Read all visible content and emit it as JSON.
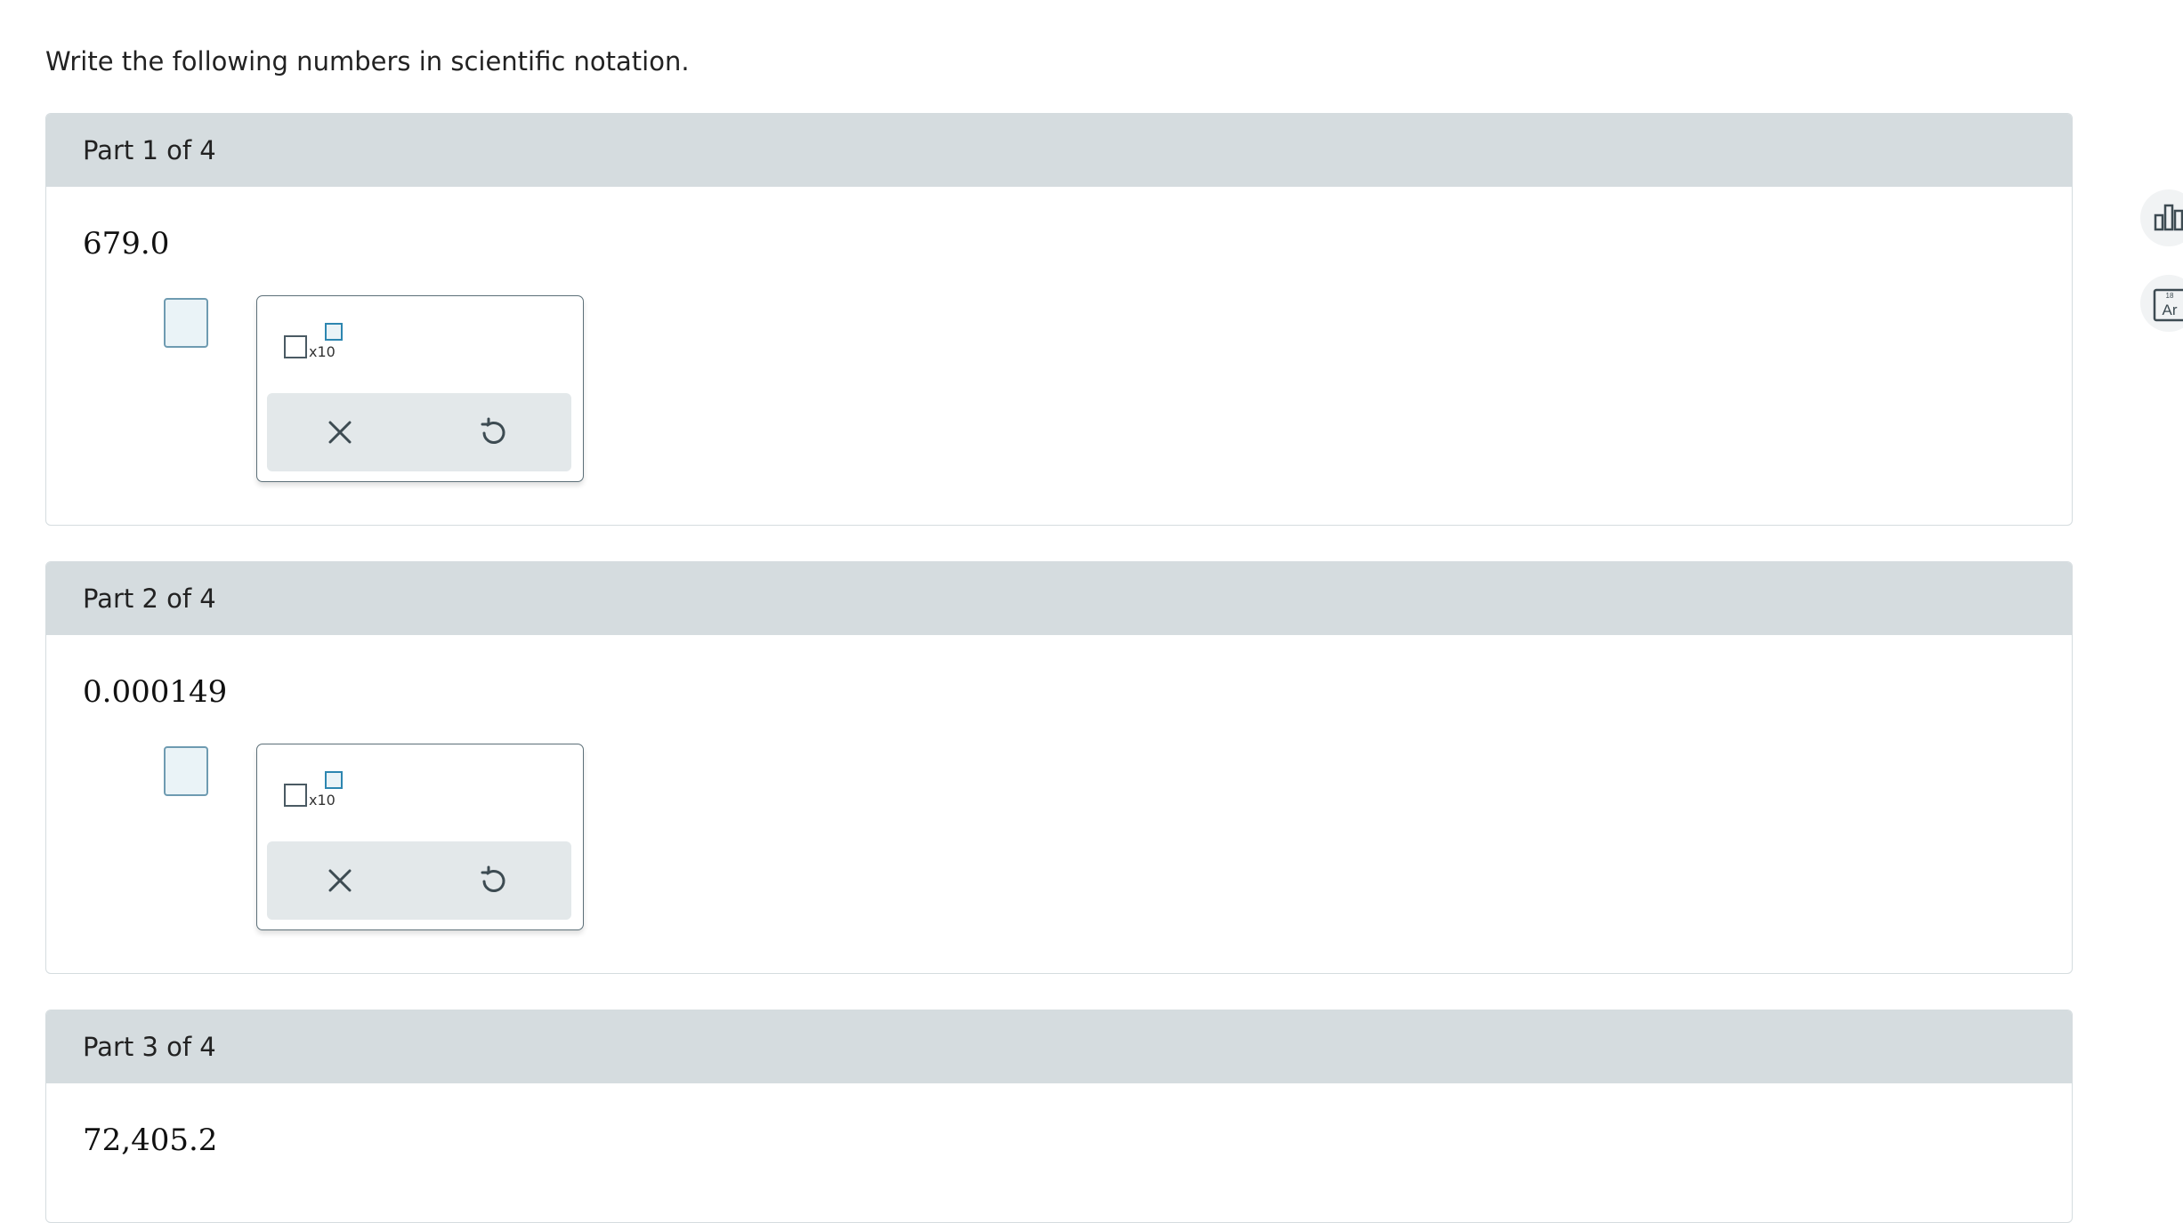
{
  "instructions": "Write the following numbers in scientific notation.",
  "parts": [
    {
      "header": "Part 1 of 4",
      "number": "679.0"
    },
    {
      "header": "Part 2 of 4",
      "number": "0.000149"
    },
    {
      "header": "Part 3 of 4",
      "number": "72,405.2"
    }
  ],
  "palette": {
    "times_ten": "x10"
  },
  "side_tools": {
    "reference_badge": "18",
    "reference_label": "Ar"
  },
  "colors": {
    "header_bg": "#d5dcdf",
    "input_bg": "#eaf3f7",
    "accent": "#2d86b0"
  }
}
